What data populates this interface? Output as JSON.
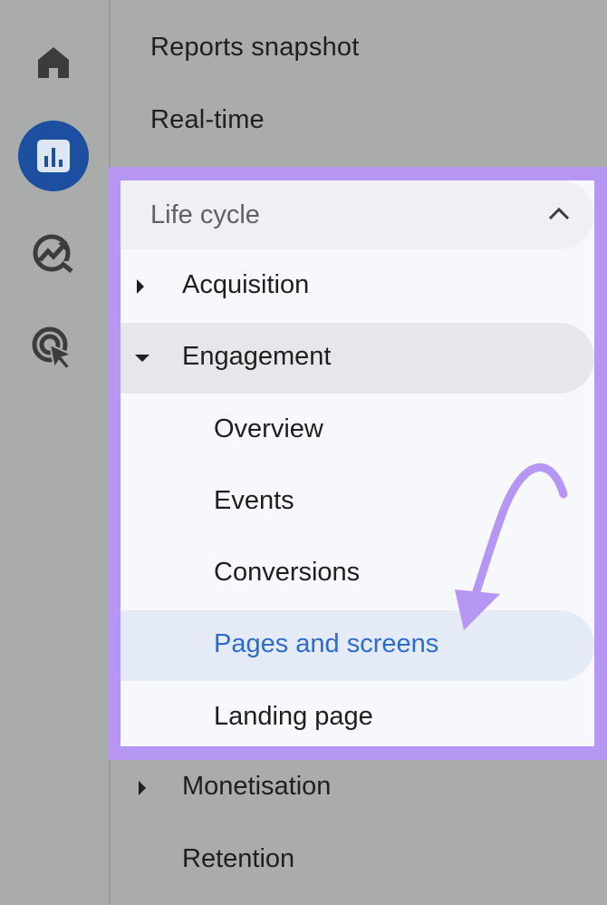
{
  "rail": {
    "items": [
      {
        "icon": "home-icon",
        "active": false
      },
      {
        "icon": "reports-icon",
        "active": true
      },
      {
        "icon": "explore-icon",
        "active": false
      },
      {
        "icon": "advertising-icon",
        "active": false
      }
    ]
  },
  "menu": {
    "top_items": [
      {
        "label": "Reports snapshot"
      },
      {
        "label": "Real-time"
      }
    ],
    "section": {
      "title": "Life cycle",
      "expanded": true,
      "items": [
        {
          "label": "Acquisition",
          "collapsed": true
        },
        {
          "label": "Engagement",
          "expanded": true,
          "children": [
            {
              "label": "Overview"
            },
            {
              "label": "Events"
            },
            {
              "label": "Conversions"
            },
            {
              "label": "Pages and screens",
              "selected": true
            },
            {
              "label": "Landing page"
            }
          ]
        }
      ]
    },
    "after_items": [
      {
        "label": "Monetisation",
        "collapsed": true
      },
      {
        "label": "Retention"
      }
    ]
  },
  "colors": {
    "highlight_border": "#b597f3",
    "active_rail": "#1d4fa0",
    "selected_text": "#2e6bcb",
    "annotation_arrow": "#b597f3"
  }
}
